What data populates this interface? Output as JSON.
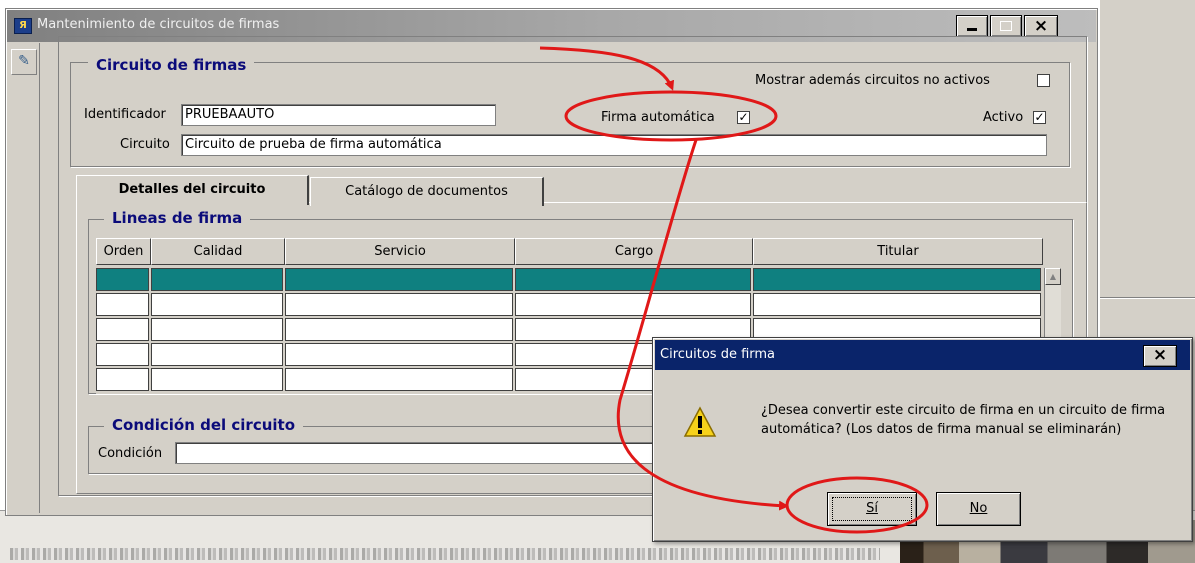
{
  "window": {
    "title": "Mantenimiento de circuitos de firmas",
    "app_icon": "app-icon",
    "close_glyph": "×"
  },
  "circuit": {
    "group_title": "Circuito de firmas",
    "show_inactive_label": "Mostrar además circuitos no activos",
    "show_inactive_checked": false,
    "identificador_label": "Identificador",
    "identificador_value": "PRUEBAAUTO",
    "firma_auto_label": "Firma automática",
    "firma_auto_checked": true,
    "activo_label": "Activo",
    "activo_checked": true,
    "circuito_label": "Circuito",
    "circuito_value": "Circuito de prueba de firma automática"
  },
  "tabs": [
    {
      "label": "Detalles del circuito",
      "active": true
    },
    {
      "label": "Catálogo de documentos",
      "active": false
    }
  ],
  "lines": {
    "group_title": "Lineas de firma",
    "columns": [
      "Orden",
      "Calidad",
      "Servicio",
      "Cargo",
      "Titular"
    ],
    "row_count": 5,
    "selected_row": 0
  },
  "condition": {
    "group_title": "Condición del circuito",
    "label": "Condición",
    "value": ""
  },
  "dialog": {
    "title": "Circuitos de firma",
    "close_glyph": "×",
    "message": "¿Desea convertir este circuito de firma en un circuito de firma automática? (Los datos de firma manual se eliminarán)",
    "yes_label": "Sí",
    "no_label": "No"
  },
  "colors": {
    "selected_row": "#0f8080",
    "dialog_title_bg": "#0a246a",
    "group_title": "#0b0b7a",
    "annotation": "#e01818"
  },
  "icons": [
    "app-icon",
    "minimize-icon",
    "maximize-icon",
    "close-icon",
    "toolbar-icon",
    "warning-icon",
    "scroll-up-icon"
  ]
}
